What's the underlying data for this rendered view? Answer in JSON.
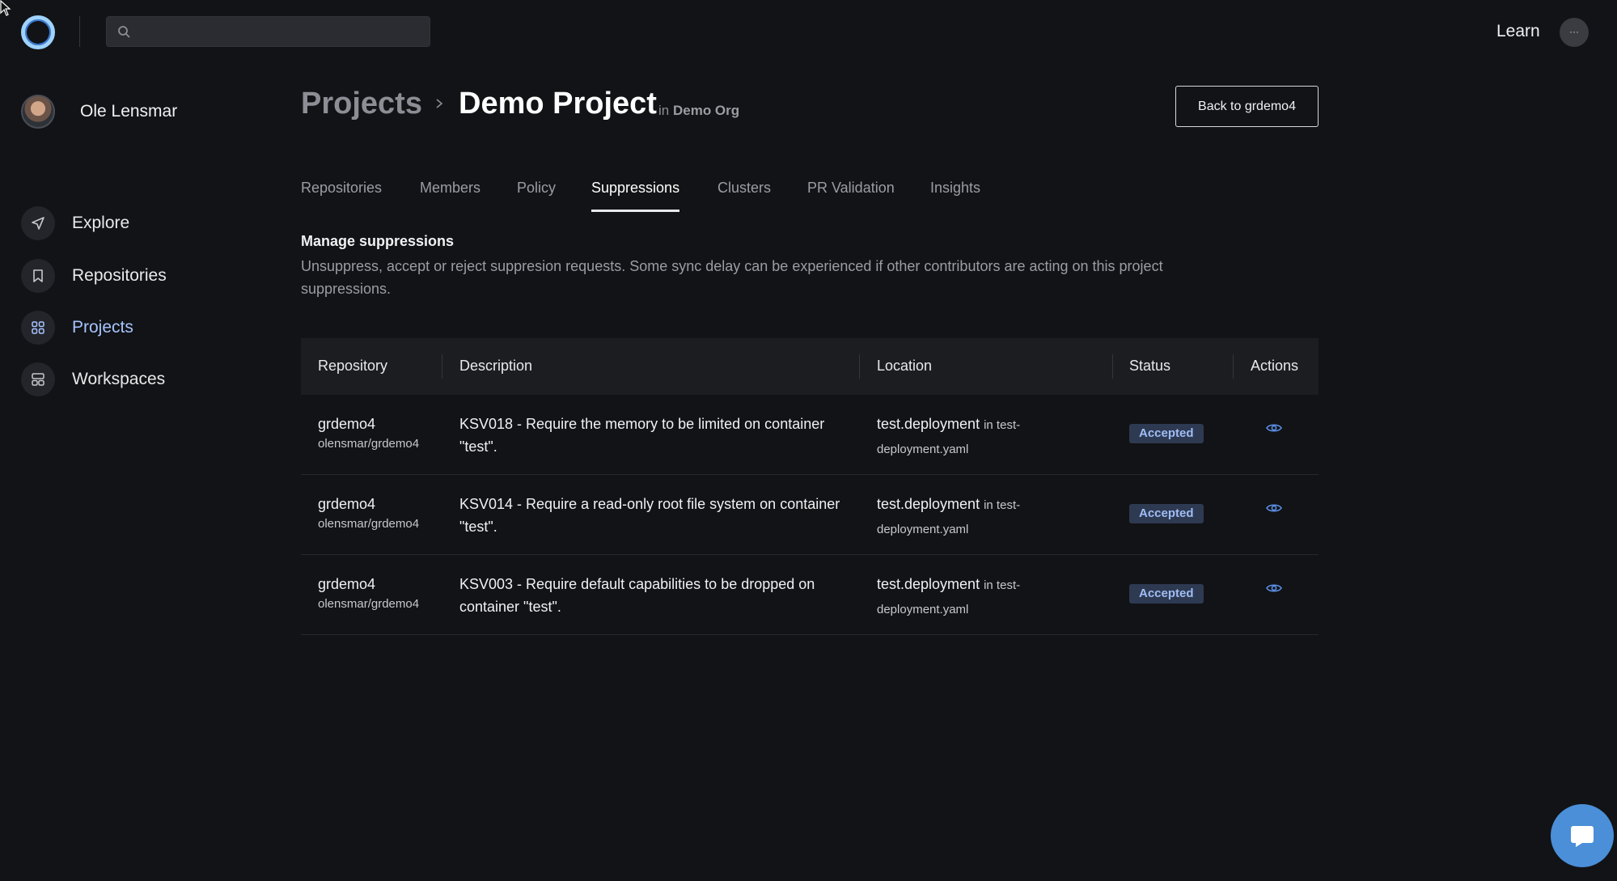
{
  "topbar": {
    "search_placeholder": "",
    "learn_label": "Learn",
    "more_label": "···"
  },
  "sidebar": {
    "user_name": "Ole Lensmar",
    "items": [
      {
        "label": "Explore",
        "icon": "send-icon"
      },
      {
        "label": "Repositories",
        "icon": "bookmark-icon"
      },
      {
        "label": "Projects",
        "icon": "grid-icon",
        "active": true
      },
      {
        "label": "Workspaces",
        "icon": "layout-icon"
      }
    ]
  },
  "header": {
    "breadcrumb_root": "Projects",
    "breadcrumb_current": "Demo Project",
    "in_prefix": "in",
    "org_name": "Demo Org",
    "back_button": "Back to grdemo4"
  },
  "tabs": [
    {
      "label": "Repositories"
    },
    {
      "label": "Members"
    },
    {
      "label": "Policy"
    },
    {
      "label": "Suppressions",
      "active": true
    },
    {
      "label": "Clusters"
    },
    {
      "label": "PR Validation"
    },
    {
      "label": "Insights"
    }
  ],
  "section": {
    "title": "Manage suppressions",
    "description": "Unsuppress, accept or reject suppresion requests. Some sync delay can be experienced if other contributors are acting on this project suppressions."
  },
  "table": {
    "columns": [
      "Repository",
      "Description",
      "Location",
      "Status",
      "Actions"
    ],
    "rows": [
      {
        "repo": "grdemo4",
        "repo_path": "olensmar/grdemo4",
        "description": "KSV018 - Require the memory to be limited on container \"test\".",
        "resource": "test.deployment",
        "file": "in test-deployment.yaml",
        "status": "Accepted"
      },
      {
        "repo": "grdemo4",
        "repo_path": "olensmar/grdemo4",
        "description": "KSV014 - Require a read-only root file system on container \"test\".",
        "resource": "test.deployment",
        "file": "in test-deployment.yaml",
        "status": "Accepted"
      },
      {
        "repo": "grdemo4",
        "repo_path": "olensmar/grdemo4",
        "description": "KSV003 - Require default capabilities to be dropped on container \"test\".",
        "resource": "test.deployment",
        "file": "in test-deployment.yaml",
        "status": "Accepted"
      }
    ]
  },
  "colors": {
    "background": "#121316",
    "accent": "#a7c4ff",
    "badge_bg": "#2e3a52",
    "badge_text": "#9fbdf5",
    "chat": "#4a8fd8"
  }
}
